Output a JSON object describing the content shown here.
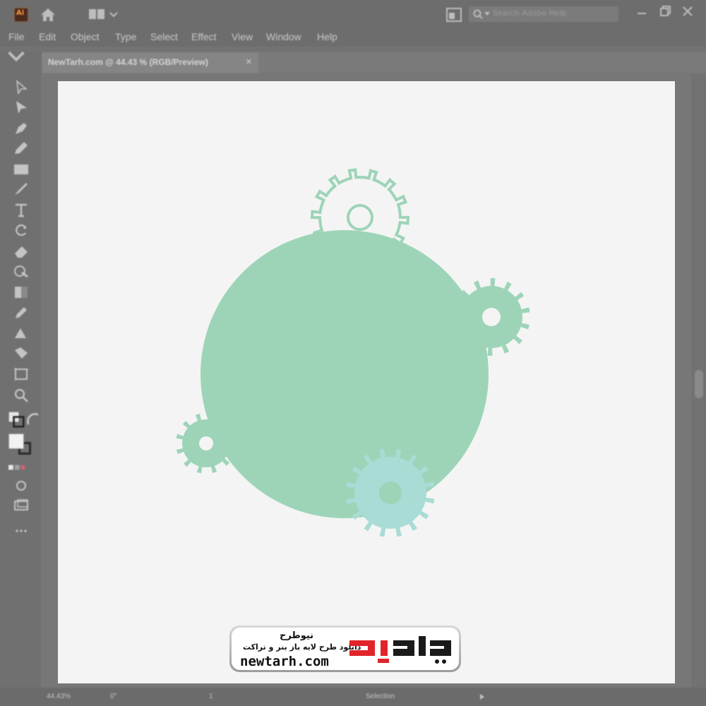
{
  "app": {
    "logo_text": "Ai",
    "search_placeholder": "Search Adobe Help"
  },
  "menu": [
    "File",
    "Edit",
    "Object",
    "Type",
    "Select",
    "Effect",
    "View",
    "Window",
    "Help"
  ],
  "document_tab": {
    "label": "NewTarh.com @ 44.43 % (RGB/Preview)",
    "close": "×"
  },
  "status": {
    "zoom": "44.43%",
    "rotation": "0°",
    "artboard": "1",
    "tool": "Selection"
  },
  "watermark": {
    "brand_fa": "نیوطرح",
    "tagline_fa": "دانلود طرح لایه باز بنر و تراکت",
    "site": "newtarh.com"
  },
  "colors": {
    "circle": "#9dd4b8",
    "gear_outline": "#9dd4b8",
    "gear_solid": "#9dd4b8",
    "gear_blue": "#a8dcd5",
    "artboard": "#f4f4f4",
    "ui_dark": "#6d6d6d",
    "brand_red": "#e0242a"
  }
}
